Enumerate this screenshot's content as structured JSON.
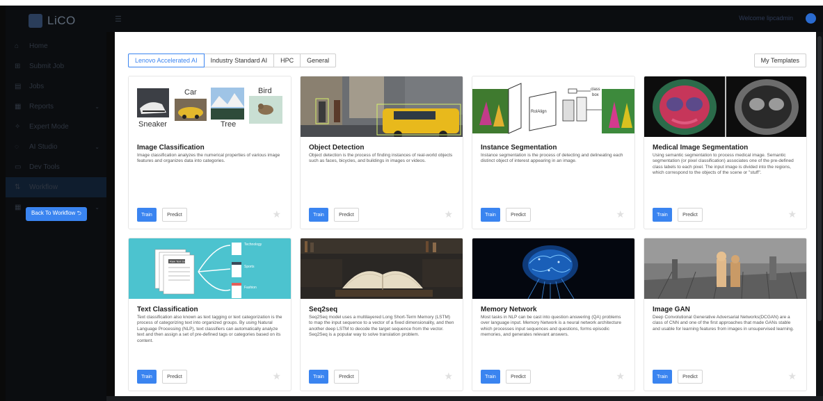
{
  "app": {
    "brand": "LiCO",
    "welcome": "Welcome lipcadmin"
  },
  "sidebar": {
    "items": [
      {
        "label": "Home",
        "icon": "home-icon",
        "glyph": "⌂"
      },
      {
        "label": "Submit Job",
        "icon": "submit-icon",
        "glyph": "⊞"
      },
      {
        "label": "Jobs",
        "icon": "jobs-icon",
        "glyph": "▤"
      },
      {
        "label": "Reports",
        "icon": "reports-icon",
        "glyph": "▦",
        "chevron": true
      },
      {
        "label": "Expert Mode",
        "icon": "expert-icon",
        "glyph": "✧"
      },
      {
        "label": "AI Studio",
        "icon": "ai-studio-icon",
        "glyph": "◌",
        "chevron": true
      },
      {
        "label": "Dev Tools",
        "icon": "dev-tools-icon",
        "glyph": "▭"
      },
      {
        "label": "Workflow",
        "icon": "workflow-icon",
        "glyph": "⇅",
        "active": true
      }
    ],
    "back_button": "Back To Workflow ⮌"
  },
  "tabs": [
    {
      "label": "Lenovo Accelerated AI",
      "active": true
    },
    {
      "label": "Industry Standard AI"
    },
    {
      "label": "HPC"
    },
    {
      "label": "General"
    }
  ],
  "templates_button": "My Templates",
  "cards": [
    {
      "title": "Image Classification",
      "desc": "Image classification analyzes the numerical properties of various image features and organizes data into categories.",
      "labels": {
        "l1": "Car",
        "l2": "Bird",
        "l3": "Sneaker",
        "l4": "Tree"
      }
    },
    {
      "title": "Object Detection",
      "desc": "Object detection is the process of finding instances of real-world objects such as faces, bicycles, and buildings in images or videos."
    },
    {
      "title": "Instance Segmentation",
      "desc": "Instance segmentation is the process of detecting and delineating each distinct object of interest appearing in an image.",
      "labels": {
        "l1": "class",
        "l2": "box",
        "l3": "RoIAlign"
      }
    },
    {
      "title": "Medical Image Segmentation",
      "desc": "Using semantic segmentation to process medical image. Semantic segmentation (or pixel classification) associates one of the pre-defined class labels to each pixel. The input image is divided into the regions, which correspond to the objects of the scene or \"stuff\"."
    },
    {
      "title": "Text Classification",
      "desc": "Text classification also known as text tagging or text categorization is the process of categorizing text into organized groups. By using Natural Language Processing (NLP), text classifiers can automatically analyze text and then assign a set of pre-defined tags or categories based on its content.",
      "labels": {
        "l1": "Raw Text Data",
        "l2": "Technology",
        "l3": "Sports",
        "l4": "Fashion"
      }
    },
    {
      "title": "Seq2seq",
      "desc": "Seq2Seq model uses a multilayered Long Short-Term Memory (LSTM) to map the input sequence to a vector of a fixed dimensionality, and then another deep LSTM to decode the target sequence from the vector. Seq2Seq is a popular way to solve translation problem."
    },
    {
      "title": "Memory Network",
      "desc": "Most tasks in NLP can be cast into question answering (QA) problems over language input. Memory Network is a neural network architecture which processes input sequences and questions, forms episodic memories, and generates relevant answers."
    },
    {
      "title": "Image GAN",
      "desc": "Deep Convolutional Generative Adversarial Networks(DCGAN) are a class of CNN and one of the first approaches that made GANs stable and usable for learning features from images in unsupervised learning."
    }
  ],
  "train_label": "Train",
  "predict_label": "Predict",
  "star_glyph": "★",
  "colors": {
    "accent": "#3a84f0",
    "sidebar": "#0b0d10",
    "page": "#ffffff"
  }
}
